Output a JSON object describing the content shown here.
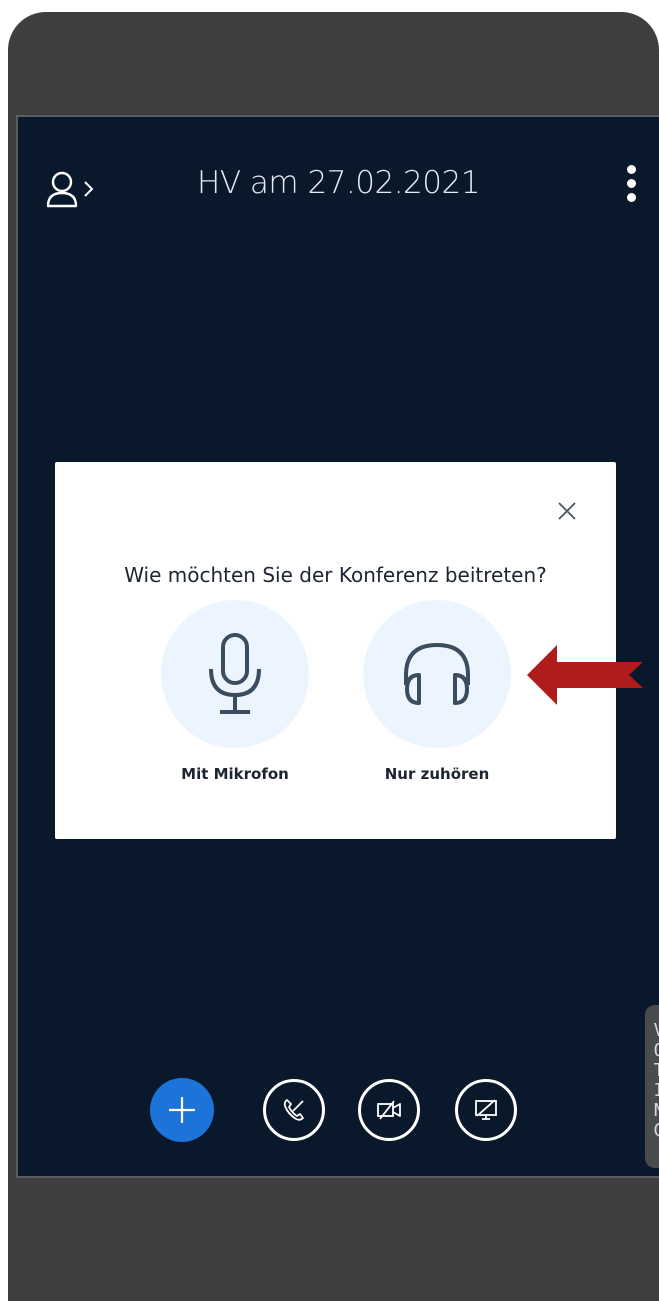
{
  "header": {
    "title": "HV am 27.02.2021"
  },
  "dialog": {
    "question": "Wie möchten Sie der Konferenz beitreten?",
    "options": [
      {
        "label": "Mit Mikrofon",
        "icon": "microphone-icon"
      },
      {
        "label": "Nur zuhören",
        "icon": "headphones-icon"
      }
    ]
  },
  "voting": {
    "label": [
      "V",
      "O",
      "T",
      "I",
      "N",
      "G"
    ]
  },
  "controls": {
    "icons": [
      "plus-icon",
      "phone-off-icon",
      "video-off-icon",
      "screen-share-off-icon"
    ]
  },
  "colors": {
    "background": "#0a182b",
    "accent": "#1c74d9",
    "arrow": "#b01c1c",
    "option_circle": "#ecf4fd"
  }
}
